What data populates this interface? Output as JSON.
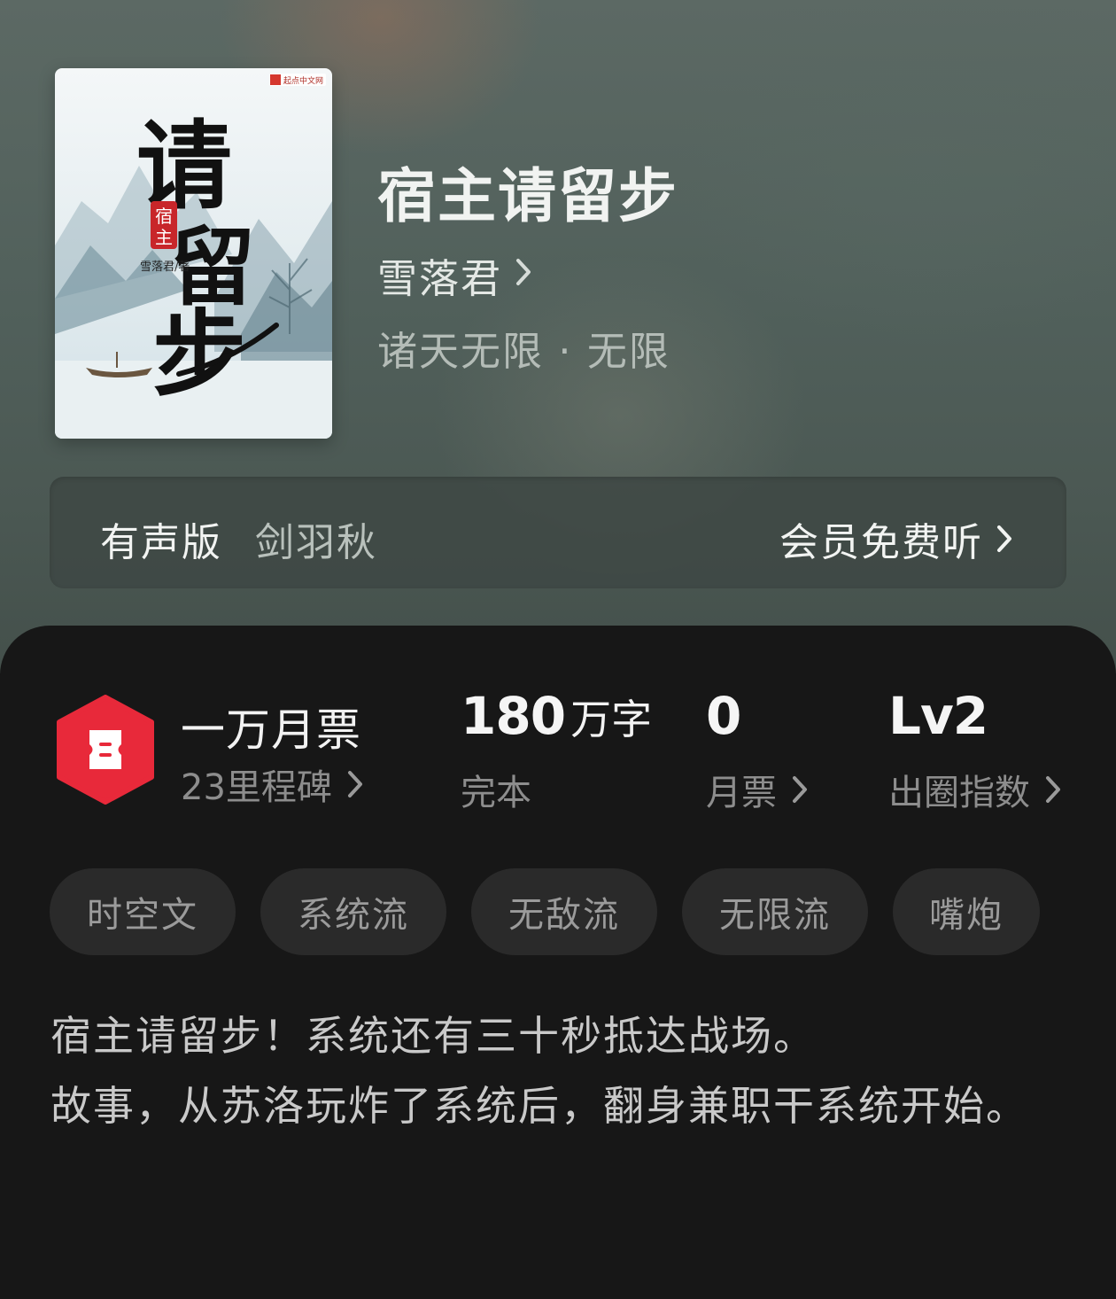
{
  "cover": {
    "publisher_mark": "起点中文网",
    "title_chars": [
      "请",
      "留",
      "步"
    ],
    "seal_text": "宿主",
    "author_credit": "雪落君/著"
  },
  "book": {
    "title": "宿主请留步",
    "author": "雪落君",
    "genre": "诸天无限 · 无限"
  },
  "audio": {
    "label": "有声版",
    "narrator": "剑羽秋",
    "action": "会员免费听"
  },
  "stats": {
    "ticket_rank": "一万月票",
    "milestone": "23里程碑",
    "word_count_number": "180",
    "word_count_unit": "万字",
    "status": "完本",
    "monthly_votes_value": "0",
    "monthly_votes_label": "月票",
    "level_value": "Lv2",
    "level_label": "出圈指数"
  },
  "tags": [
    "时空文",
    "系统流",
    "无敌流",
    "无限流",
    "嘴炮"
  ],
  "description": [
    "宿主请留步！系统还有三十秒抵达战场。",
    "故事，从苏洛玩炸了系统后，翻身兼职干系统开始。"
  ],
  "colors": {
    "accent_red": "#e8293a",
    "panel_bg": "#171717",
    "tag_bg": "#2a2a2a"
  }
}
